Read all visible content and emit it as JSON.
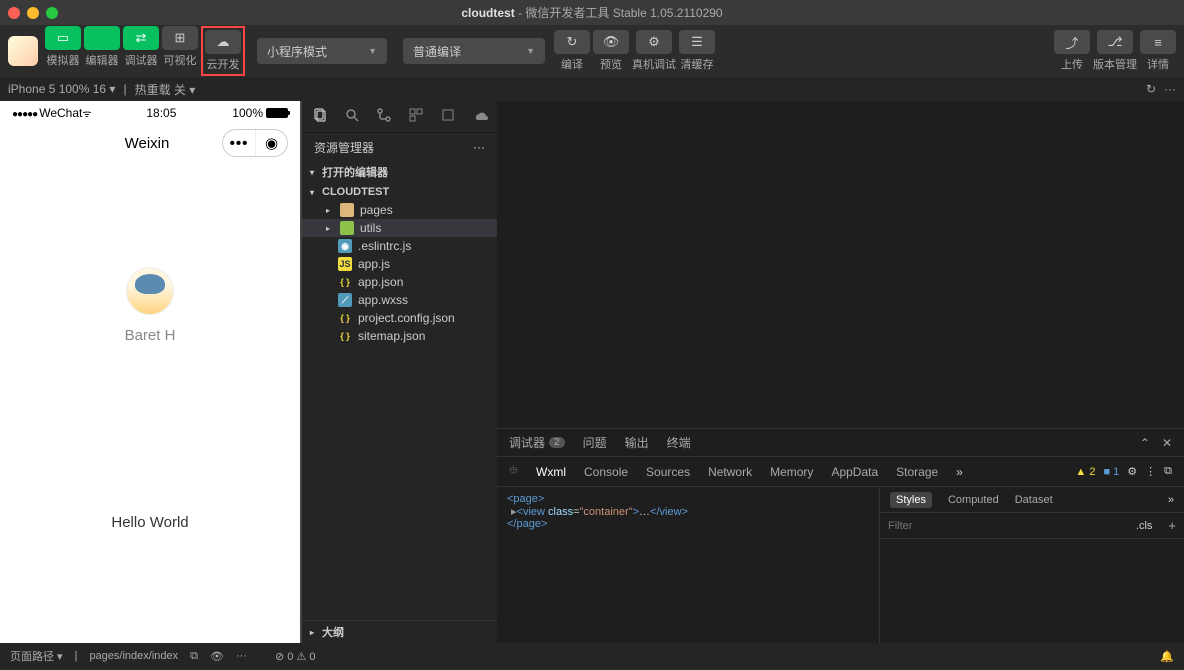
{
  "title": {
    "app": "cloudtest",
    "suffix": "- 微信开发者工具 Stable 1.05.2110290"
  },
  "toolbar": {
    "buttons": [
      {
        "label": "模拟器",
        "cls": "green"
      },
      {
        "label": "编辑器",
        "cls": "green"
      },
      {
        "label": "调试器",
        "cls": "green"
      },
      {
        "label": "可视化",
        "cls": "gray"
      },
      {
        "label": "云开发",
        "cls": "gray"
      }
    ],
    "mode": "小程序模式",
    "compile": "普通编译",
    "center": [
      {
        "label": "编译"
      },
      {
        "label": "预览"
      },
      {
        "label": "真机调试"
      },
      {
        "label": "清缓存"
      }
    ],
    "right": [
      {
        "label": "上传"
      },
      {
        "label": "版本管理"
      },
      {
        "label": "详情"
      }
    ]
  },
  "subtoolbar": {
    "device": "iPhone 5 100% 16 ▾",
    "hot": "热重载 关 ▾"
  },
  "simulator": {
    "signal": "●●●●●",
    "carrier": "WeChat",
    "time": "18:05",
    "battery": "100%",
    "title": "Weixin",
    "username": "Baret H",
    "content": "Hello World"
  },
  "explorer": {
    "title": "资源管理器",
    "openEditors": "打开的编辑器",
    "project": "CLOUDTEST",
    "tree": [
      {
        "type": "folder",
        "name": "pages",
        "icon": "folder-o"
      },
      {
        "type": "folder",
        "name": "utils",
        "icon": "folder-g",
        "selected": true
      },
      {
        "type": "file",
        "name": ".eslintrc.js",
        "icon": "js-blue"
      },
      {
        "type": "file",
        "name": "app.js",
        "icon": "js"
      },
      {
        "type": "file",
        "name": "app.json",
        "icon": "json"
      },
      {
        "type": "file",
        "name": "app.wxss",
        "icon": "wxss"
      },
      {
        "type": "file",
        "name": "project.config.json",
        "icon": "json"
      },
      {
        "type": "file",
        "name": "sitemap.json",
        "icon": "json"
      }
    ],
    "outline": "大纲"
  },
  "debugger": {
    "tabs": [
      {
        "label": "调试器",
        "badge": "2"
      },
      {
        "label": "问题"
      },
      {
        "label": "输出"
      },
      {
        "label": "终端"
      }
    ],
    "panels": [
      "Wxml",
      "Console",
      "Sources",
      "Network",
      "Memory",
      "AppData",
      "Storage"
    ],
    "activePanel": "Wxml",
    "indicators": {
      "warn": "2",
      "info": "1"
    },
    "wxml": {
      "line1": "<page>",
      "line2": "▸<view class=\"container\">…</view>",
      "line3": "</page>"
    },
    "styles": {
      "tabs": [
        "Styles",
        "Computed",
        "Dataset"
      ],
      "active": "Styles",
      "filterPlaceholder": "Filter",
      "cls": ".cls"
    }
  },
  "statusbar": {
    "left": "页面路径 ▾",
    "path": "pages/index/index",
    "errors": "0",
    "warnings": "0"
  }
}
